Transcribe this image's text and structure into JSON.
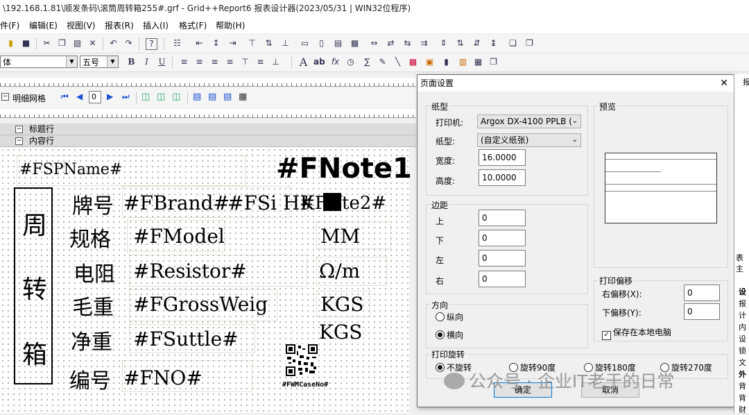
{
  "window": {
    "title": "\\192.168.1.81\\顺发条码\\滚筒周转箱255#.grf - Grid++Report6 报表设计器(2023/05/31 | WIN32位程序)"
  },
  "menu": [
    "件(F)",
    "编辑(E)",
    "视图(V)",
    "报表(R)",
    "插入(I)",
    "格式(F)",
    "帮助(H)"
  ],
  "format_bar": {
    "font_name": "体",
    "font_size": "五号"
  },
  "grid_toolbar": {
    "label": "明细网格",
    "page_value": "0"
  },
  "sections": {
    "title_row": "标题行",
    "content_row": "内容行"
  },
  "report": {
    "vertical_title": [
      "周",
      "转",
      "箱"
    ],
    "sp_name": "#FSPName#",
    "note1": "#FNote1",
    "brand_label": "牌号",
    "brand_field": "#FBrand#",
    "si_field": "#FSi",
    "hk_field": "HK",
    "note2_field": "#FN",
    "note2_tail": "te2#",
    "spec_label": "规格",
    "model_field": "#FModel",
    "mm": "MM",
    "resistor_label": "电阻",
    "resistor_field": "#Resistor#",
    "ohm": "Ω/m",
    "gross_label": "毛重",
    "gross_field": "#FGrossWeig",
    "kgs1": "KGS",
    "net_label": "净重",
    "net_field": "#FSuttle#",
    "kgs2": "KGS",
    "no_label": "编号",
    "no_field": "#FNO#",
    "qr_caption": "#FWMCaseNo#"
  },
  "dialog": {
    "title": "页面设置",
    "paper_group": "纸型",
    "printer_label": "打印机:",
    "printer_value": "Argox DX-4100 PPLB (",
    "paper_label": "纸型:",
    "paper_value": "(自定义纸张)",
    "width_label": "宽度:",
    "width_value": "16.0000",
    "height_label": "高度:",
    "height_value": "10.0000",
    "margin_group": "边距",
    "top_label": "上",
    "top_value": "0",
    "bottom_label": "下",
    "bottom_value": "0",
    "left_label": "左",
    "left_value": "0",
    "right_label": "右",
    "right_value": "0",
    "orientation_group": "方向",
    "portrait": "纵向",
    "landscape": "横向",
    "preview_group": "预览",
    "offset_group": "打印偏移",
    "offset_right_label": "右偏移(X):",
    "offset_right_value": "0",
    "offset_down_label": "下偏移(Y):",
    "offset_down_value": "0",
    "save_local": "保存在本地电脑",
    "rotation_group": "打印旋转",
    "rot_none": "不旋转",
    "rot_90": "旋转90度",
    "rot_180": "旋转180度",
    "rot_270": "旋转270度",
    "ok": "确定",
    "cancel": "取消"
  },
  "right_panel": {
    "header": "报",
    "table_label": "表主",
    "items": [
      "设",
      "报",
      "计",
      "内",
      "设",
      "锁",
      "文",
      "外",
      "背",
      "背",
      "财"
    ]
  },
  "watermark": "公众号 · 企业IT老于的日常"
}
